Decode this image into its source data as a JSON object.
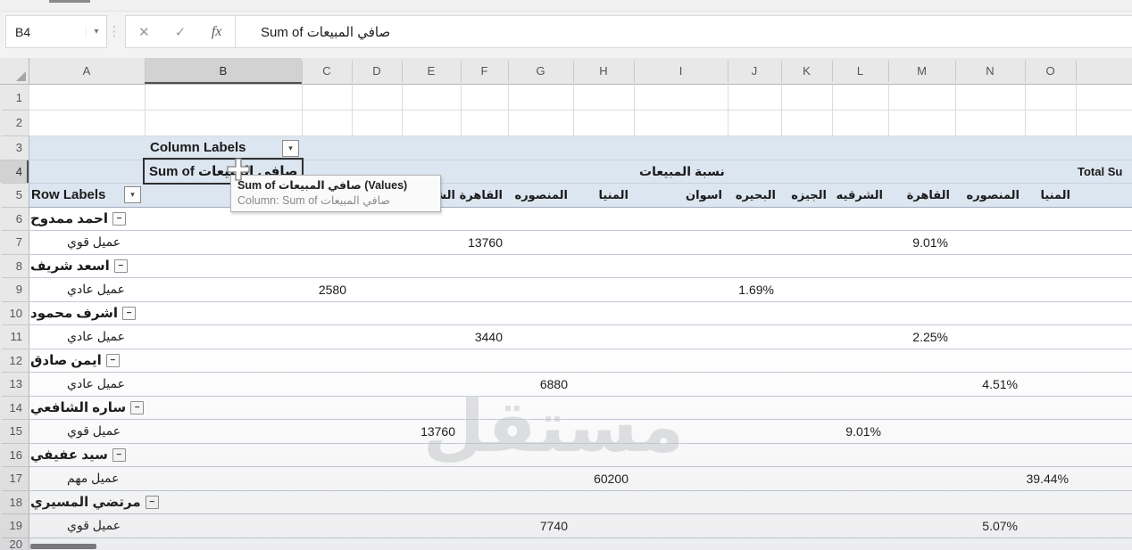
{
  "formula_bar": {
    "name_box_value": "B4",
    "name_box_dropdown": "▾",
    "cancel_label": "✕",
    "enter_label": "✓",
    "fx_label": "fx",
    "formula_text": "Sum of صافي المبيعات"
  },
  "grid": {
    "column_letters": [
      "A",
      "B",
      "C",
      "D",
      "E",
      "F",
      "G",
      "H",
      "I",
      "J",
      "K",
      "L",
      "M",
      "N",
      "O",
      ""
    ],
    "row_numbers": [
      "1",
      "2",
      "3",
      "4",
      "5",
      "6",
      "7",
      "8",
      "9",
      "10",
      "11",
      "12",
      "13",
      "14",
      "15",
      "16",
      "17",
      "18",
      "19",
      "20"
    ],
    "selected_column": "B",
    "selected_row": "4"
  },
  "pivot": {
    "column_labels": "Column Labels",
    "row_labels": "Row Labels",
    "dropdown_glyph": "▾",
    "collapse_glyph": "−",
    "value_field_header": "Sum of صافي المبيعات",
    "pct_field_header": "نسبة المبيعات",
    "total_header": "Total Su",
    "col_headers": [
      {
        "col": "E",
        "label": "الشرقيه"
      },
      {
        "col": "F",
        "label": "القاهرة"
      },
      {
        "col": "G",
        "label": "المنصوره"
      },
      {
        "col": "H",
        "label": "المنيا"
      },
      {
        "col": "I",
        "label": "اسوان"
      },
      {
        "col": "J",
        "label": "البحيره"
      },
      {
        "col": "K",
        "label": "الجيزه"
      },
      {
        "col": "L",
        "label": "الشرقيه"
      },
      {
        "col": "M",
        "label": "القاهرة"
      },
      {
        "col": "N",
        "label": "المنصوره"
      },
      {
        "col": "O",
        "label": "المنيا"
      }
    ],
    "rows": [
      {
        "row": 6,
        "type": "group",
        "label": "احمد ممدوح"
      },
      {
        "row": 7,
        "type": "detail",
        "label": "عميل قوي",
        "value_col": "F",
        "value": "13760",
        "pct_col": "M",
        "pct": "9.01%"
      },
      {
        "row": 8,
        "type": "group",
        "label": "اسعد شريف"
      },
      {
        "row": 9,
        "type": "detail",
        "label": "عميل عادي",
        "value_col": "C",
        "value": "2580",
        "pct_col": "J",
        "pct": "1.69%"
      },
      {
        "row": 10,
        "type": "group",
        "label": "اشرف محمود"
      },
      {
        "row": 11,
        "type": "detail",
        "label": "عميل عادي",
        "value_col": "F",
        "value": "3440",
        "pct_col": "M",
        "pct": "2.25%"
      },
      {
        "row": 12,
        "type": "group",
        "label": "ايمن صادق"
      },
      {
        "row": 13,
        "type": "detail",
        "label": "عميل عادي",
        "value_col": "G",
        "value": "6880",
        "pct_col": "N",
        "pct": "4.51%"
      },
      {
        "row": 14,
        "type": "group",
        "label": "ساره الشافعي"
      },
      {
        "row": 15,
        "type": "detail",
        "label": "عميل قوي",
        "value_col": "E",
        "value": "13760",
        "pct_col": "L",
        "pct": "9.01%"
      },
      {
        "row": 16,
        "type": "group",
        "label": "سيد عفيفي"
      },
      {
        "row": 17,
        "type": "detail",
        "label": "عميل مهم",
        "value_col": "H",
        "value": "60200",
        "pct_col": "O",
        "pct": "39.44%"
      },
      {
        "row": 18,
        "type": "group",
        "label": "مرتضي المسيري"
      },
      {
        "row": 19,
        "type": "detail",
        "label": "عميل قوي",
        "value_col": "G",
        "value": "7740",
        "pct_col": "N",
        "pct": "5.07%"
      },
      {
        "row": 20,
        "type": "group",
        "label": ""
      }
    ]
  },
  "tooltip": {
    "line1": "Sum of صافي المبيعات (Values)",
    "line2": "Column: Sum of صافي المبيعات"
  },
  "watermark": "مستقل"
}
